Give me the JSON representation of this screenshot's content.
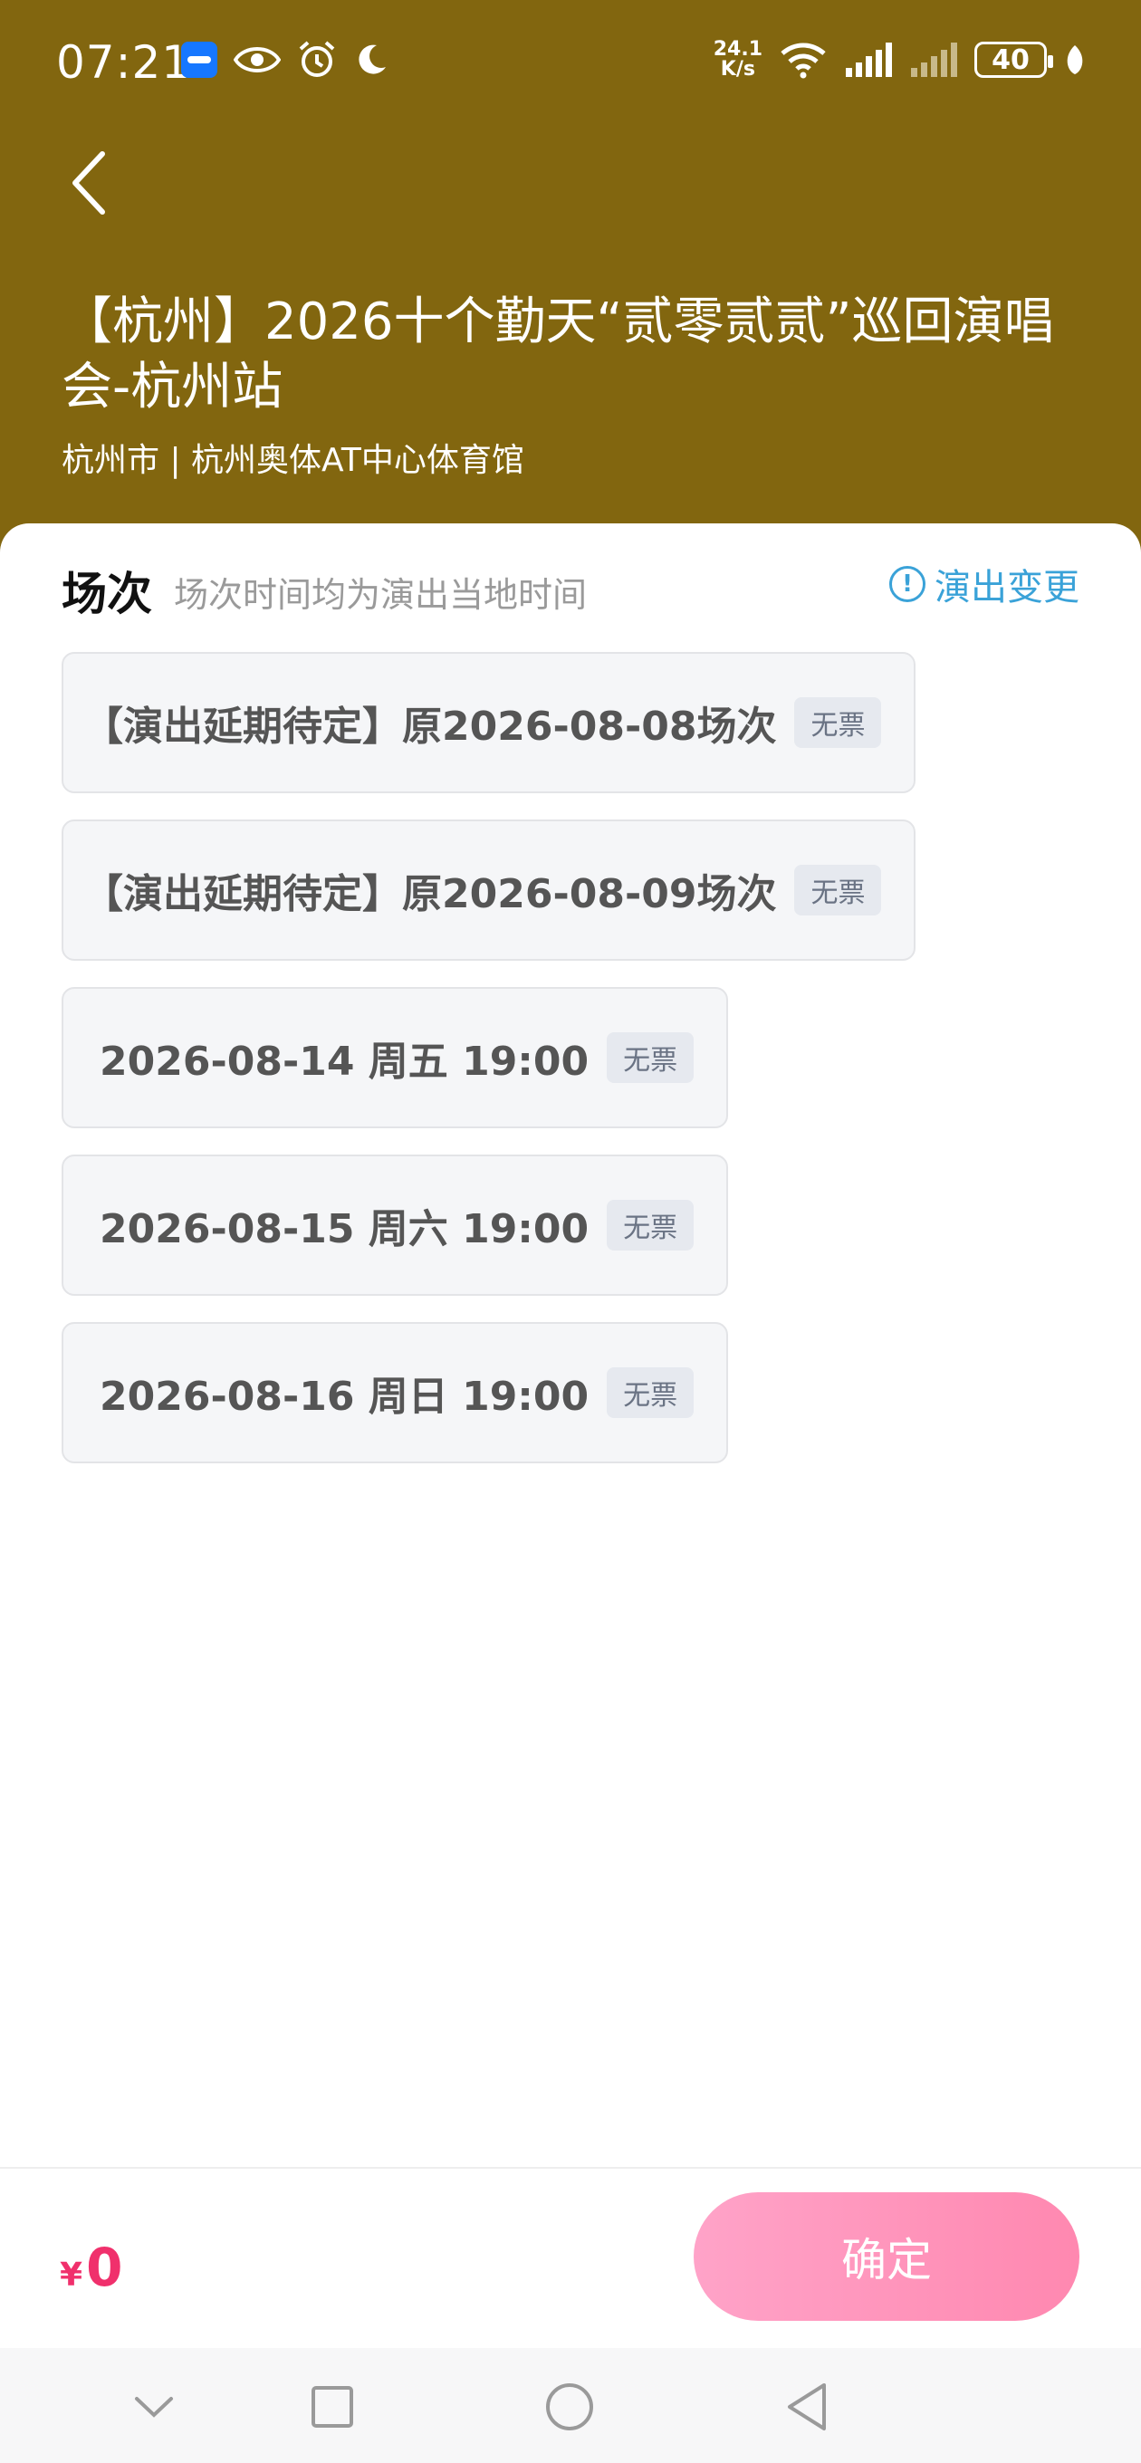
{
  "status_bar": {
    "time": "07:21",
    "net_speed_value": "24.1",
    "net_speed_unit": "K/s",
    "battery": "40"
  },
  "header": {
    "title": "【杭州】2026十个勤天“贰零贰贰”巡回演唱会-杭州站",
    "venue": "杭州市 | 杭州奥体AT中心体育馆"
  },
  "sessions": {
    "title": "场次",
    "note": "场次时间均为演出当地时间",
    "change_link": "演出变更",
    "items": [
      {
        "label": "【演出延期待定】原2026-08-08场次",
        "tag": "无票"
      },
      {
        "label": "【演出延期待定】原2026-08-09场次",
        "tag": "无票"
      },
      {
        "label": "2026-08-14 周五 19:00",
        "tag": "无票"
      },
      {
        "label": "2026-08-15 周六 19:00",
        "tag": "无票"
      },
      {
        "label": "2026-08-16 周日 19:00",
        "tag": "无票"
      }
    ]
  },
  "bottom": {
    "currency": "¥",
    "price": "0",
    "confirm_label": "确定"
  },
  "colors": {
    "header_bg": "#82660f",
    "accent_pink": "#f0306c",
    "link_blue": "#3aa2d8"
  }
}
